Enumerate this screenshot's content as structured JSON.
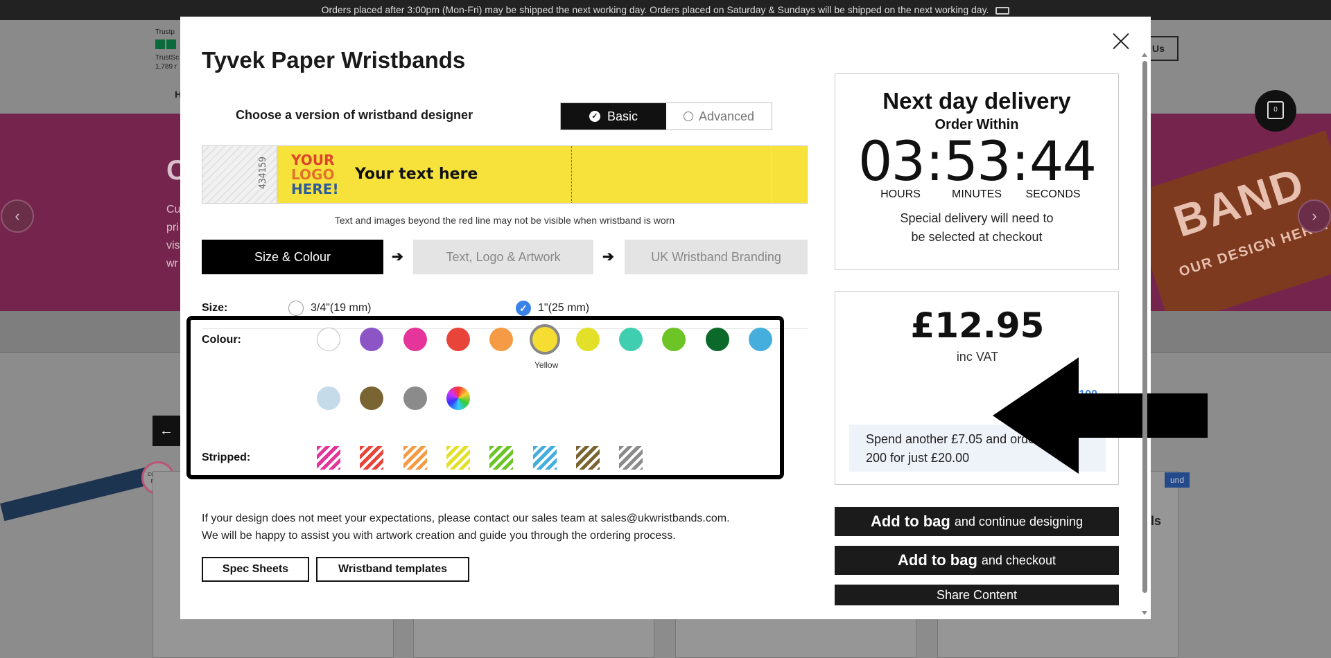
{
  "banner": {
    "text": "Orders placed after 3:00pm (Mon-Fri) may be shipped the next working day. Orders placed on Saturday & Sundays will be shipped on the next working day."
  },
  "background": {
    "trust_line1": "Trustp",
    "trust_line2": "TrustSc",
    "trust_line3": "1,789 r",
    "contact_label": "Us",
    "nav_first": "H",
    "hero_title": "C",
    "hero_lines": [
      "Cu",
      "pri",
      "vis",
      "wr"
    ],
    "banner_art": "BAND",
    "banner_art_sub": "OUR DESIGN HERE!",
    "bag_count": "0",
    "colour_print_badge": "COLOUR PRINT",
    "round_badge": "und",
    "card_partial": "ls"
  },
  "modal": {
    "title": "Tyvek Paper Wristbands",
    "designer_label": "Choose a version of wristband designer",
    "version_basic": "Basic",
    "version_advanced": "Advanced",
    "preview": {
      "serial": "434159",
      "logo_lines": [
        "YOUR",
        "LOGO",
        "HERE!"
      ],
      "text": "Your text here",
      "color": "#f7e23c"
    },
    "preview_note": "Text and images beyond the red line may not be visible when wristband is worn",
    "steps": [
      "Size & Colour",
      "Text, Logo & Artwork",
      "UK Wristband Branding"
    ],
    "size": {
      "label": "Size:",
      "options": [
        "3/4\"(19 mm)",
        "1\"(25 mm)"
      ],
      "selected": "1\"(25 mm)"
    },
    "colour": {
      "label": "Colour:",
      "selected_name": "Yellow",
      "solid": [
        "#ffffff",
        "#8b55c6",
        "#e5349a",
        "#e8443a",
        "#f59a45",
        "#f5dd32",
        "#e2e029",
        "#3fcfb0",
        "#6cc426",
        "#0b6a2a",
        "#45aedc",
        "#c6dbea",
        "#7a6431",
        "#8b8b8b",
        "multicolor"
      ]
    },
    "stripped": {
      "label": "Stripped:",
      "colors": [
        "#e5349a",
        "#e8443a",
        "#f59a45",
        "#e2e029",
        "#6cc426",
        "#45aedc",
        "#7a6431",
        "#8b8b8b"
      ]
    },
    "help_text_1": "If your design does not meet your expectations, please contact our sales team at sales@ukwristbands.com.",
    "help_text_2": "We will be happy to assist you with artwork creation and guide you through the ordering process.",
    "spec_sheets": "Spec Sheets",
    "templates": "Wristband templates",
    "delivery": {
      "title": "Next day delivery",
      "sub": "Order Within",
      "hours": "03",
      "minutes": "53",
      "seconds": "44",
      "label_hours": "HOURS",
      "label_minutes": "MINUTES",
      "label_seconds": "SECONDS",
      "note_1": "Special delivery will need to",
      "note_2": "be selected at checkout"
    },
    "pricing": {
      "price": "£12.95",
      "inc_vat": "inc VAT",
      "min": "Min: 100",
      "upsell_1": "Spend another £7.05 and order",
      "upsell_2": "200 for just £20.00"
    },
    "buttons": {
      "add_bag_bold": "Add to bag",
      "add_continue": "and continue designing",
      "add_checkout": "and checkout",
      "share": "Share Content"
    }
  }
}
